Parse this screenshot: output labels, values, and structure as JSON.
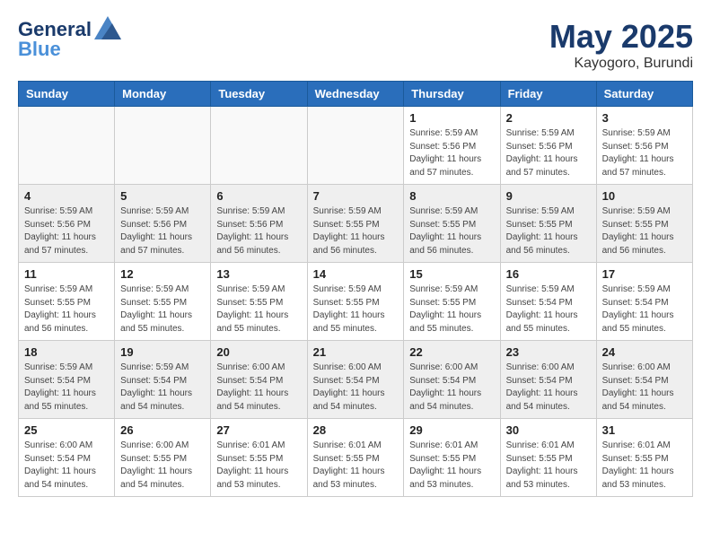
{
  "header": {
    "logo_line1": "General",
    "logo_line2": "Blue",
    "month": "May 2025",
    "location": "Kayogoro, Burundi"
  },
  "days_of_week": [
    "Sunday",
    "Monday",
    "Tuesday",
    "Wednesday",
    "Thursday",
    "Friday",
    "Saturday"
  ],
  "weeks": [
    [
      {
        "day": "",
        "info": ""
      },
      {
        "day": "",
        "info": ""
      },
      {
        "day": "",
        "info": ""
      },
      {
        "day": "",
        "info": ""
      },
      {
        "day": "1",
        "info": "Sunrise: 5:59 AM\nSunset: 5:56 PM\nDaylight: 11 hours\nand 57 minutes."
      },
      {
        "day": "2",
        "info": "Sunrise: 5:59 AM\nSunset: 5:56 PM\nDaylight: 11 hours\nand 57 minutes."
      },
      {
        "day": "3",
        "info": "Sunrise: 5:59 AM\nSunset: 5:56 PM\nDaylight: 11 hours\nand 57 minutes."
      }
    ],
    [
      {
        "day": "4",
        "info": "Sunrise: 5:59 AM\nSunset: 5:56 PM\nDaylight: 11 hours\nand 57 minutes."
      },
      {
        "day": "5",
        "info": "Sunrise: 5:59 AM\nSunset: 5:56 PM\nDaylight: 11 hours\nand 57 minutes."
      },
      {
        "day": "6",
        "info": "Sunrise: 5:59 AM\nSunset: 5:56 PM\nDaylight: 11 hours\nand 56 minutes."
      },
      {
        "day": "7",
        "info": "Sunrise: 5:59 AM\nSunset: 5:55 PM\nDaylight: 11 hours\nand 56 minutes."
      },
      {
        "day": "8",
        "info": "Sunrise: 5:59 AM\nSunset: 5:55 PM\nDaylight: 11 hours\nand 56 minutes."
      },
      {
        "day": "9",
        "info": "Sunrise: 5:59 AM\nSunset: 5:55 PM\nDaylight: 11 hours\nand 56 minutes."
      },
      {
        "day": "10",
        "info": "Sunrise: 5:59 AM\nSunset: 5:55 PM\nDaylight: 11 hours\nand 56 minutes."
      }
    ],
    [
      {
        "day": "11",
        "info": "Sunrise: 5:59 AM\nSunset: 5:55 PM\nDaylight: 11 hours\nand 56 minutes."
      },
      {
        "day": "12",
        "info": "Sunrise: 5:59 AM\nSunset: 5:55 PM\nDaylight: 11 hours\nand 55 minutes."
      },
      {
        "day": "13",
        "info": "Sunrise: 5:59 AM\nSunset: 5:55 PM\nDaylight: 11 hours\nand 55 minutes."
      },
      {
        "day": "14",
        "info": "Sunrise: 5:59 AM\nSunset: 5:55 PM\nDaylight: 11 hours\nand 55 minutes."
      },
      {
        "day": "15",
        "info": "Sunrise: 5:59 AM\nSunset: 5:55 PM\nDaylight: 11 hours\nand 55 minutes."
      },
      {
        "day": "16",
        "info": "Sunrise: 5:59 AM\nSunset: 5:54 PM\nDaylight: 11 hours\nand 55 minutes."
      },
      {
        "day": "17",
        "info": "Sunrise: 5:59 AM\nSunset: 5:54 PM\nDaylight: 11 hours\nand 55 minutes."
      }
    ],
    [
      {
        "day": "18",
        "info": "Sunrise: 5:59 AM\nSunset: 5:54 PM\nDaylight: 11 hours\nand 55 minutes."
      },
      {
        "day": "19",
        "info": "Sunrise: 5:59 AM\nSunset: 5:54 PM\nDaylight: 11 hours\nand 54 minutes."
      },
      {
        "day": "20",
        "info": "Sunrise: 6:00 AM\nSunset: 5:54 PM\nDaylight: 11 hours\nand 54 minutes."
      },
      {
        "day": "21",
        "info": "Sunrise: 6:00 AM\nSunset: 5:54 PM\nDaylight: 11 hours\nand 54 minutes."
      },
      {
        "day": "22",
        "info": "Sunrise: 6:00 AM\nSunset: 5:54 PM\nDaylight: 11 hours\nand 54 minutes."
      },
      {
        "day": "23",
        "info": "Sunrise: 6:00 AM\nSunset: 5:54 PM\nDaylight: 11 hours\nand 54 minutes."
      },
      {
        "day": "24",
        "info": "Sunrise: 6:00 AM\nSunset: 5:54 PM\nDaylight: 11 hours\nand 54 minutes."
      }
    ],
    [
      {
        "day": "25",
        "info": "Sunrise: 6:00 AM\nSunset: 5:54 PM\nDaylight: 11 hours\nand 54 minutes."
      },
      {
        "day": "26",
        "info": "Sunrise: 6:00 AM\nSunset: 5:55 PM\nDaylight: 11 hours\nand 54 minutes."
      },
      {
        "day": "27",
        "info": "Sunrise: 6:01 AM\nSunset: 5:55 PM\nDaylight: 11 hours\nand 53 minutes."
      },
      {
        "day": "28",
        "info": "Sunrise: 6:01 AM\nSunset: 5:55 PM\nDaylight: 11 hours\nand 53 minutes."
      },
      {
        "day": "29",
        "info": "Sunrise: 6:01 AM\nSunset: 5:55 PM\nDaylight: 11 hours\nand 53 minutes."
      },
      {
        "day": "30",
        "info": "Sunrise: 6:01 AM\nSunset: 5:55 PM\nDaylight: 11 hours\nand 53 minutes."
      },
      {
        "day": "31",
        "info": "Sunrise: 6:01 AM\nSunset: 5:55 PM\nDaylight: 11 hours\nand 53 minutes."
      }
    ]
  ]
}
